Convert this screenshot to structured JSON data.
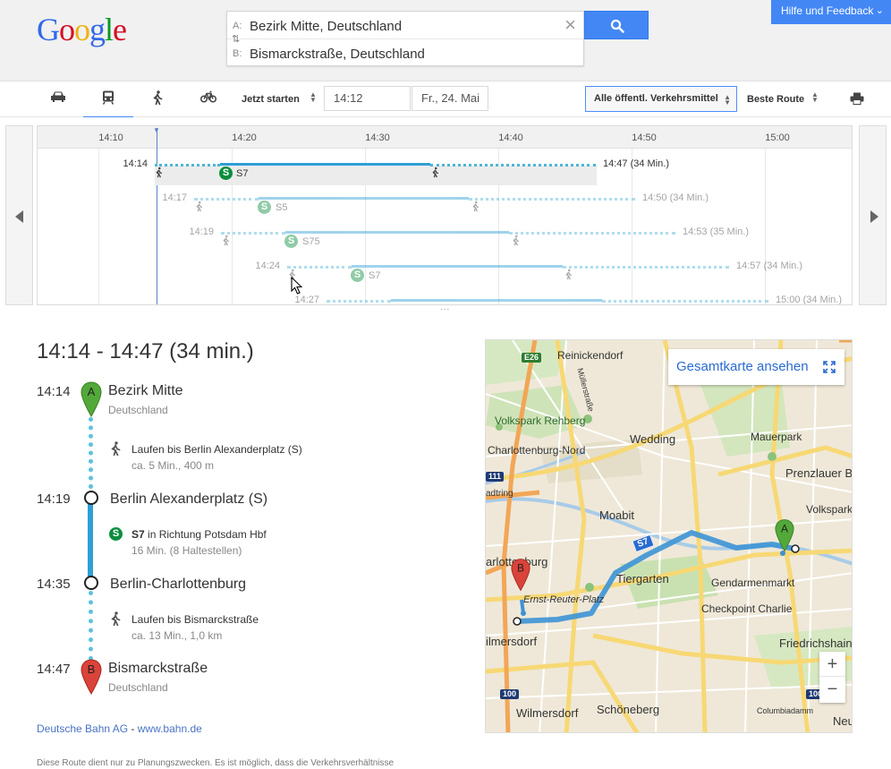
{
  "logo": {
    "letters": [
      "G",
      "o",
      "o",
      "g",
      "l",
      "e"
    ],
    "colors": [
      "#3369e8",
      "#d50f25",
      "#eeb211",
      "#3369e8",
      "#009925",
      "#d50f25"
    ]
  },
  "feedback": {
    "label": "Hilfe und Feedback"
  },
  "search": {
    "from_label": "A:",
    "from_value": "Bezirk Mitte, Deutschland",
    "to_label": "B:",
    "to_value": "Bismarckstraße, Deutschland"
  },
  "toolbar": {
    "start_label": "Jetzt starten",
    "time_value": "14:12",
    "date_value": "Fr., 24. Mai",
    "transit_filter": "Alle öffentl. Verkehrsmittel",
    "route_pref": "Beste Route"
  },
  "timeline": {
    "ticks": [
      "14:10",
      "14:20",
      "14:30",
      "14:40",
      "14:50",
      "15:00"
    ],
    "rows": [
      {
        "dep": "14:14",
        "line": "S7",
        "arr": "14:47 (34 Min.)"
      },
      {
        "dep": "14:17",
        "line": "S5",
        "arr": "14:50 (34 Min.)"
      },
      {
        "dep": "14:19",
        "line": "S75",
        "arr": "14:53 (35 Min.)"
      },
      {
        "dep": "14:24",
        "line": "S7",
        "arr": "14:57 (34 Min.)"
      },
      {
        "dep": "14:27",
        "line": "",
        "arr": "15:00 (34 Min.)"
      }
    ],
    "more": "..."
  },
  "itinerary": {
    "summary": "14:14 - 14:47 (34 min.)",
    "start": {
      "time": "14:14",
      "name": "Bezirk Mitte",
      "sub": "Deutschland",
      "pin": "A"
    },
    "walk1": {
      "text": "Laufen bis Berlin Alexanderplatz (S)",
      "sub": "ca. 5 Min., 400 m"
    },
    "stop1": {
      "time": "14:19",
      "name": "Berlin Alexanderplatz (S)"
    },
    "ride": {
      "line": "S7",
      "text": " in Richtung Potsdam Hbf",
      "sub": "16 Min. (8 Haltestellen)"
    },
    "stop2": {
      "time": "14:35",
      "name": "Berlin-Charlottenburg"
    },
    "walk2": {
      "text": "Laufen bis Bismarckstraße",
      "sub": "ca. 13 Min., 1,0 km"
    },
    "end": {
      "time": "14:47",
      "name": "Bismarckstraße",
      "sub": "Deutschland",
      "pin": "B"
    }
  },
  "footer": {
    "agency": "Deutsche Bahn AG",
    "sep": " - ",
    "url": "www.bahn.de",
    "disclaimer": "Diese Route dient nur zu Planungszwecken. Es ist möglich, dass die Verkehrsverhältnisse"
  },
  "map": {
    "view_full": "Gesamtkarte ansehen",
    "zoom_in": "+",
    "zoom_out": "−",
    "route_label": "S7",
    "pin_a": "A",
    "pin_b": "B",
    "badges": [
      "E26",
      "111",
      "100",
      "100"
    ],
    "labels": {
      "reinickendorf": "Reinickendorf",
      "muellerstr": "Müllerstraße",
      "rehberg": "Volkspark Rehberg",
      "charl_nord": "Charlottenburg-Nord",
      "wedding": "Wedding",
      "mauerpark": "Mauerpark",
      "prenzlauer": "Prenzlauer B",
      "volkspark": "Volkspark",
      "ring": "adtring",
      "moabit": "Moabit",
      "charlottenburg": "arlottenburg",
      "tiergarten": "Tiergarten",
      "gendarmen": "Gendarmenmarkt",
      "ernst": "Ernst-Reuter-Platz",
      "checkpoint": "Checkpoint Charlie",
      "wilmersdorf1": "ilmersdorf",
      "friedrichshain": "Friedrichshain",
      "wilmersdorf2": "Wilmersdorf",
      "schoeneberg": "Schöneberg",
      "columbia": "Columbiadamm",
      "neu": "Neu"
    }
  },
  "colors": {
    "accent": "#4387f5",
    "transit": "#2f9fd6",
    "sbahn": "#0b8e3d",
    "pin_a": "#52a93a",
    "pin_b": "#d9433a"
  }
}
